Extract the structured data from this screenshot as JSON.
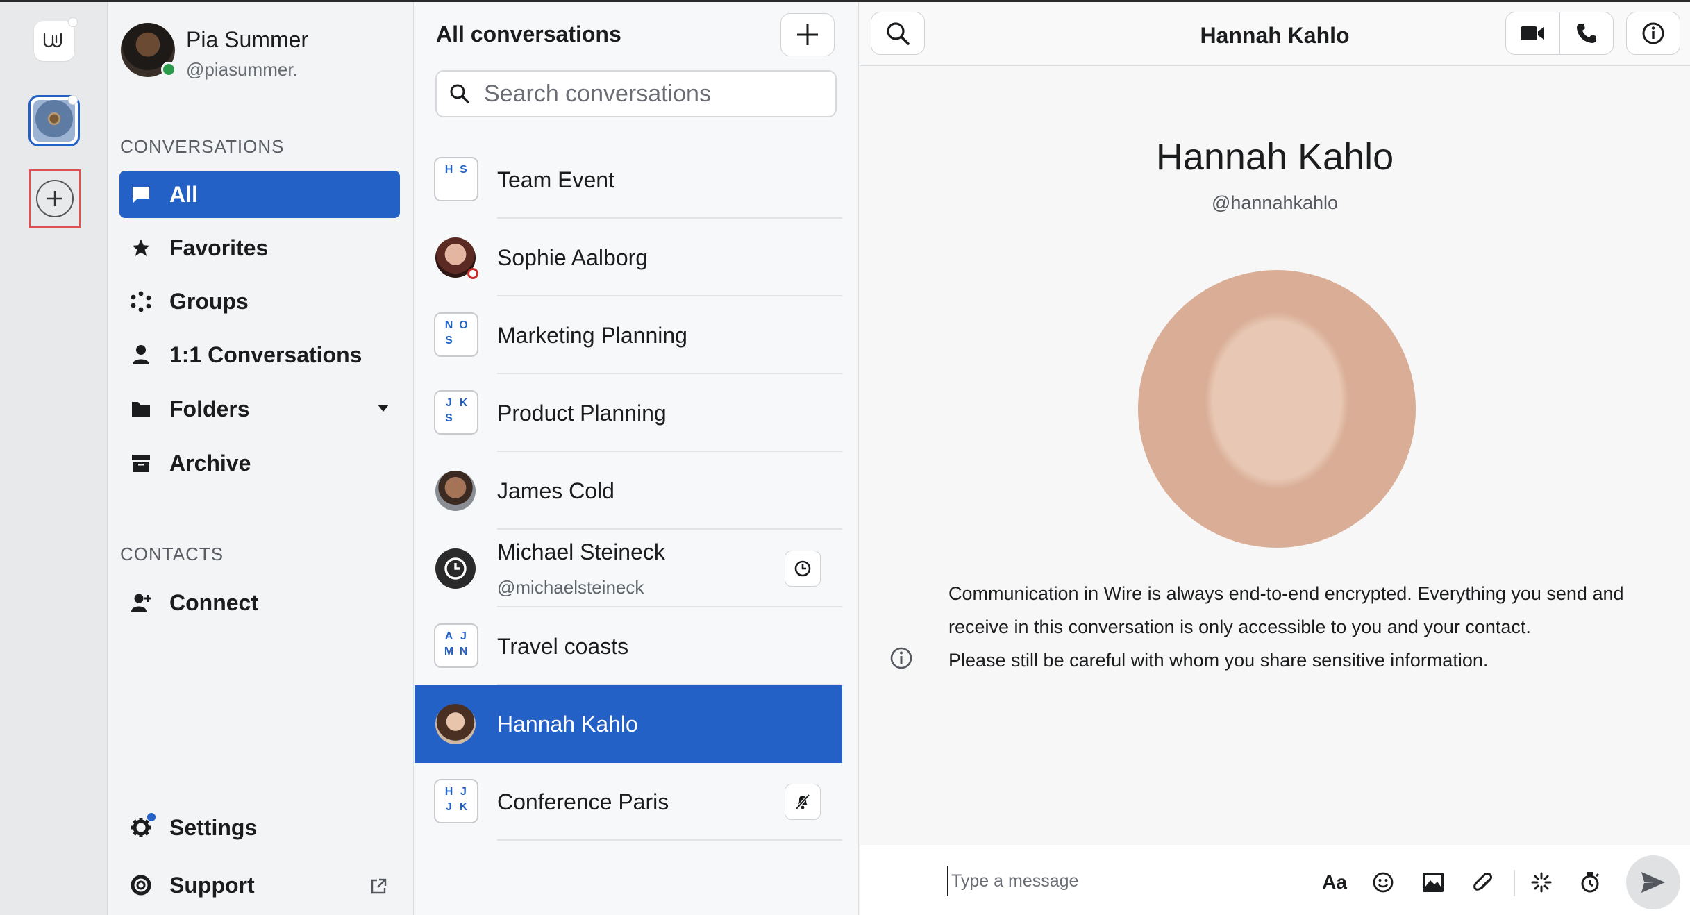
{
  "app": {
    "accent": "#2461c7"
  },
  "user": {
    "name": "Pia Summer",
    "handle": "@piasummer."
  },
  "sidebar": {
    "conversations_label": "CONVERSATIONS",
    "items": [
      {
        "label": "All",
        "icon": "chat-bubble-icon",
        "active": true
      },
      {
        "label": "Favorites",
        "icon": "star-icon"
      },
      {
        "label": "Groups",
        "icon": "groups-icon"
      },
      {
        "label": "1:1 Conversations",
        "icon": "person-icon"
      },
      {
        "label": "Folders",
        "icon": "folder-icon"
      },
      {
        "label": "Archive",
        "icon": "archive-icon"
      }
    ],
    "contacts_label": "CONTACTS",
    "connect_label": "Connect",
    "settings_label": "Settings",
    "support_label": "Support"
  },
  "convlist": {
    "title": "All conversations",
    "search_placeholder": "Search conversations",
    "rows": [
      {
        "name": "Team Event",
        "type": "group",
        "initials": [
          "H",
          "S",
          "",
          ""
        ]
      },
      {
        "name": "Sophie Aalborg",
        "type": "person"
      },
      {
        "name": "Marketing Planning",
        "type": "group",
        "initials": [
          "N",
          "O",
          "S",
          ""
        ]
      },
      {
        "name": "Product Planning",
        "type": "group",
        "initials": [
          "J",
          "K",
          "S",
          ""
        ]
      },
      {
        "name": "James Cold",
        "type": "person"
      },
      {
        "name": "Michael Steineck",
        "sub": "@michaelsteineck",
        "type": "timer"
      },
      {
        "name": "Travel coasts",
        "type": "group",
        "initials": [
          "A",
          "J",
          "M",
          "N"
        ]
      },
      {
        "name": "Hannah Kahlo",
        "type": "person",
        "active": true
      },
      {
        "name": "Conference Paris",
        "type": "group",
        "initials": [
          "H",
          "J",
          "J",
          "K"
        ]
      }
    ]
  },
  "main": {
    "header_title": "Hannah Kahlo",
    "profile_name": "Hannah Kahlo",
    "profile_handle": "@hannahkahlo",
    "encryption_line1": "Communication in Wire is always end-to-end encrypted. Everything you send and",
    "encryption_line2": "receive in this conversation is only accessible to you and your contact.",
    "encryption_line3": "Please still be careful with whom you share sensitive information.",
    "composer_placeholder": "Type a message",
    "format_label": "Aa"
  }
}
